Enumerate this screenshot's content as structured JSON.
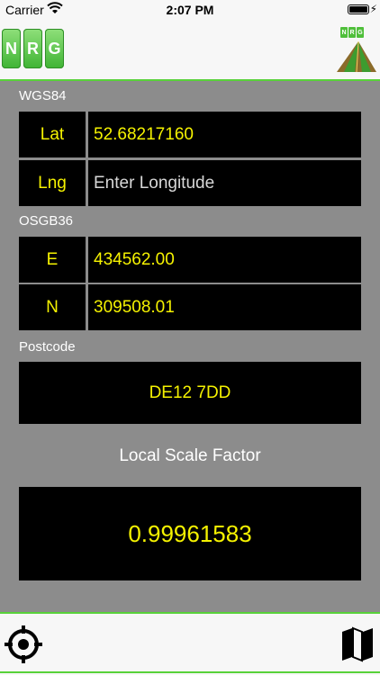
{
  "status_bar": {
    "carrier": "Carrier",
    "time": "2:07 PM"
  },
  "header": {
    "logo_letters": [
      "N",
      "R",
      "G"
    ]
  },
  "wgs84": {
    "label": "WGS84",
    "lat_label": "Lat",
    "lat_value": "52.68217160",
    "lng_label": "Lng",
    "lng_value": "",
    "lng_placeholder": "Enter Longitude"
  },
  "osgb36": {
    "label": "OSGB36",
    "e_label": "E",
    "e_value": "434562.00",
    "n_label": "N",
    "n_value": "309508.01"
  },
  "postcode": {
    "label": "Postcode",
    "value": "DE12 7DD"
  },
  "scale": {
    "label": "Local Scale Factor",
    "value": "0.99961583"
  },
  "colors": {
    "accent": "#58d23a",
    "value_text": "#f5f200",
    "background": "#8c8c8c"
  },
  "icons": {
    "location": "crosshair-icon",
    "map": "map-icon"
  }
}
